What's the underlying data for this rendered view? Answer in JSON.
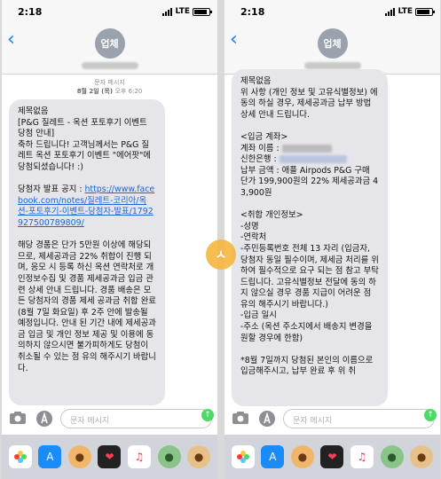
{
  "status_bar": {
    "time": "2:18",
    "network": "LTE",
    "battery_level": 0.9
  },
  "header": {
    "avatar_text": "업체"
  },
  "left": {
    "meta_label": "문자 메시지",
    "meta_date_prefix": "8월 2일 (목) ",
    "meta_date_time": "오후 6:20",
    "message_parts": {
      "p1": "제목없음\n[P&G 질레트 - 옥션 포토후기 이벤트 당첨 안내]\n축하 드립니다! 고객님께서는 P&G 질레트 옥션 포토후기 이벤트 \"에어팟\"에 당첨되셨습니다! :)\n\n당첨자 발표 공지 : ",
      "link": "https://www.facebook.com/notes/질레트-코리아/옥션-포토후기-이벤트-당첨자-발표/1792927500789809/",
      "p2": "\n\n해당 경품은 단가 5만원 이상에 해당되므로, 제세공과금 22% 취합이 진행 되며, 응모 시 등록 하신 옥션 연락처로 개인정보수집 및 경품 제세공과금 입금 관련 상세 안내 드립니다. 경품 배송은 모든 당첨자의 경품 제세 공과금 취합 완료 (8월 7일 화요일) 후 2주 안에 발송될 예정입니다. 안내 된 기간 내에 제세공과금 입금 및 개인 정보 제공 및 이용에 동의하지 않으시면 불가피하게도 당첨이 취소될 수 있는 점 유의 해주시기 바랍니다."
    }
  },
  "right": {
    "parts": {
      "p1": "제목없음\n위 사항 (개인 정보 및 고유식별정보) 에 동의 하실 경우, 제세공과금 납부 방법 상세 안내 드립니다.\n\n<입금 계좌>\n계좌 이름 : ",
      "p2": "\n신한은행 : ",
      "p3": "\n납부 금액 : 애플 Airpods P&G 구매 단가 199,900원의 22% 제세공과금 43,900원\n\n<취합 개인정보>\n-성명\n-연락처\n-주민등록번호 전체 13 자리 (입금자, 당첨자 동일 필수이며, 제세금 처리를 위하여 필수적으로 요구 되는 점 참고 부탁드립니다. 고유식별정보 전달에 동의 하지 않으실 경우 경품 지급이 어려운 점 유의 해주시기 바랍니다.)\n-입금 일시\n-주소 (옥션 주소지에서 배송지 변경을 원할 경우에 한함)\n\n*8월 7일까지 당첨된 본인의 이름으로 입금해주시고, 납부 완료 후 위 취"
    }
  },
  "compose": {
    "placeholder": "문자 메시지"
  },
  "watermark": {
    "text": "ㅅ"
  },
  "app_drawer": {
    "icons": [
      "photos-icon",
      "app-store-icon",
      "memoji-icon",
      "heart-icon",
      "music-icon",
      "sticker-icon",
      "memoji-icon"
    ]
  },
  "colors": {
    "link": "#1a66d8",
    "ios_blue": "#1a7ef5",
    "send_green": "#4cd964",
    "bubble_gray": "#e5e5ea"
  }
}
